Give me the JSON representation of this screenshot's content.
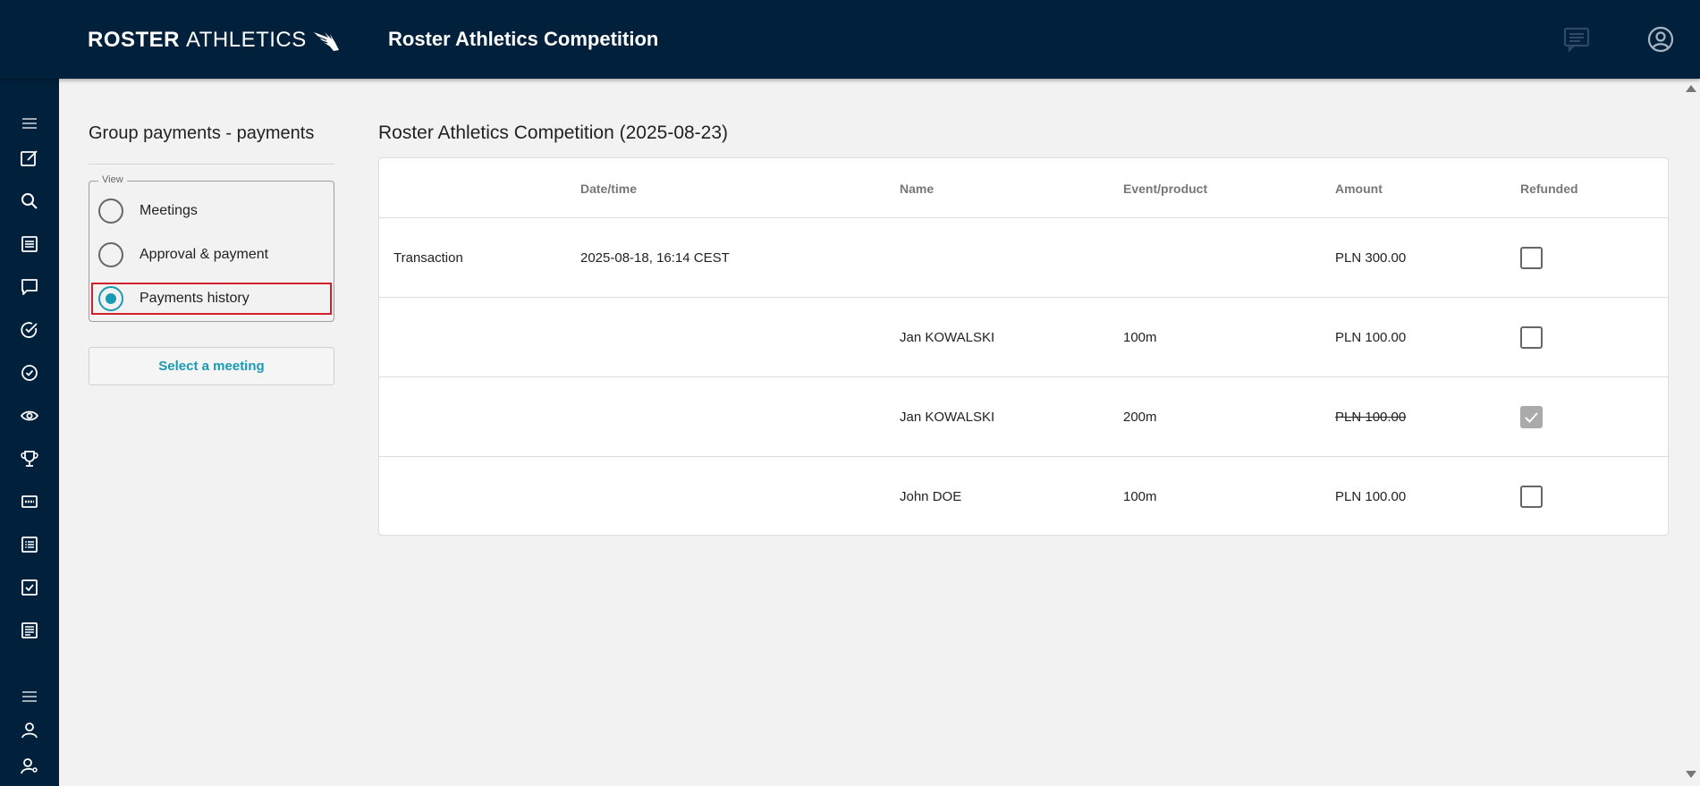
{
  "brand": {
    "logo_bold": "ROSTER",
    "logo_light": "ATHLETICS",
    "app_title": "Roster Athletics Competition"
  },
  "topbar": {
    "icons": [
      "chat-icon",
      "account-icon"
    ]
  },
  "sidebar": {
    "icons": [
      "menu-icon",
      "edit-icon",
      "search-icon",
      "list-icon",
      "message-icon",
      "check-circle-icon",
      "check-circle-small-icon",
      "eye-icon",
      "trophy-icon",
      "bib-icon",
      "document-list-icon",
      "checkbox-icon",
      "notes-icon",
      "menu-icon",
      "user-icon",
      "user-key-icon"
    ]
  },
  "left_panel": {
    "title": "Group payments - payments",
    "view_legend": "View",
    "options": [
      {
        "label": "Meetings",
        "selected": false
      },
      {
        "label": "Approval & payment",
        "selected": false
      },
      {
        "label": "Payments history",
        "selected": true
      }
    ],
    "select_button": "Select a meeting"
  },
  "main": {
    "title": "Roster Athletics Competition (2025-08-23)",
    "columns": [
      "Date/time",
      "Name",
      "Event/product",
      "Amount",
      "Refunded"
    ],
    "rows": [
      {
        "type": "Transaction",
        "datetime": "2025-08-18, 16:14 CEST",
        "name": "",
        "event": "",
        "amount": "PLN 300.00",
        "refunded": false,
        "struck": false
      },
      {
        "type": "",
        "datetime": "",
        "name": "Jan KOWALSKI",
        "event": "100m",
        "amount": "PLN 100.00",
        "refunded": false,
        "struck": false
      },
      {
        "type": "",
        "datetime": "",
        "name": "Jan KOWALSKI",
        "event": "200m",
        "amount": "PLN 100.00",
        "refunded": true,
        "struck": true
      },
      {
        "type": "",
        "datetime": "",
        "name": "John DOE",
        "event": "100m",
        "amount": "PLN 100.00",
        "refunded": false,
        "struck": false
      }
    ]
  },
  "colors": {
    "nav_bg": "#01203c",
    "accent": "#1a9ab3",
    "highlight": "#d0202c"
  }
}
